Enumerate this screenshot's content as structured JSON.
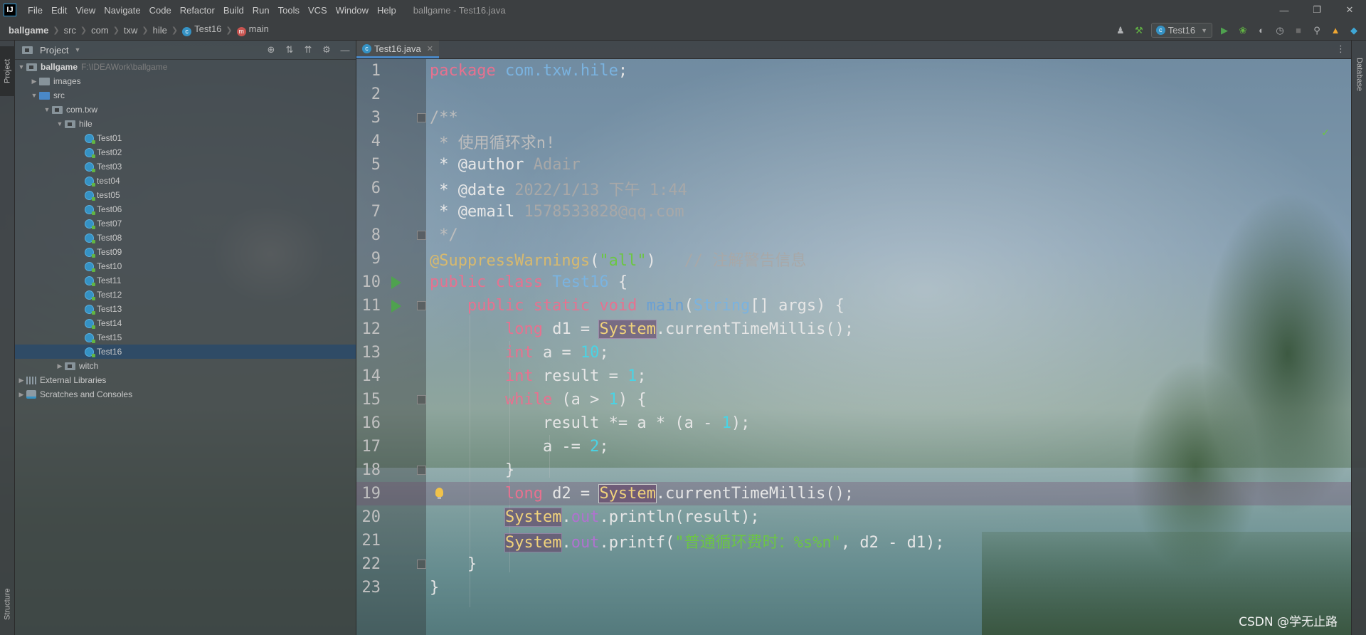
{
  "app": {
    "logo": "IJ",
    "menu": [
      "File",
      "Edit",
      "View",
      "Navigate",
      "Code",
      "Refactor",
      "Build",
      "Run",
      "Tools",
      "VCS",
      "Window",
      "Help"
    ],
    "window_title": "ballgame - Test16.java"
  },
  "breadcrumb": {
    "items": [
      "ballgame",
      "src",
      "com",
      "txw",
      "hile"
    ],
    "class_name": "Test16",
    "method_name": "main"
  },
  "toolbar": {
    "run_config": "Test16",
    "icons": [
      "user-icon",
      "build-hammer-icon",
      "run-icon",
      "debug-icon",
      "coverage-icon",
      "profile-icon",
      "stop-icon",
      "search-icon",
      "update-icon",
      "plugin-icon"
    ]
  },
  "side": {
    "project_label": "Project",
    "structure_label": "Structure",
    "database_label": "Database"
  },
  "project_panel": {
    "title": "Project",
    "root": {
      "name": "ballgame",
      "path": "F:\\IDEAWork\\ballgame"
    },
    "folders": {
      "images": "images",
      "src": "src",
      "pkg": "com.txw",
      "hile": "hile",
      "witch": "witch"
    },
    "files": [
      "Test01",
      "Test02",
      "Test03",
      "test04",
      "test05",
      "Test06",
      "Test07",
      "Test08",
      "Test09",
      "Test10",
      "Test11",
      "Test12",
      "Test13",
      "Test14",
      "Test15",
      "Test16"
    ],
    "selected_file": "Test16",
    "external_libraries": "External Libraries",
    "scratches": "Scratches and Consoles"
  },
  "editor": {
    "tab": "Test16.java",
    "line_numbers": [
      "1",
      "2",
      "3",
      "4",
      "5",
      "6",
      "7",
      "8",
      "9",
      "10",
      "11",
      "12",
      "13",
      "14",
      "15",
      "16",
      "17",
      "18",
      "19",
      "20",
      "21",
      "22",
      "23"
    ],
    "code": {
      "l1_kw": "package",
      "l1_pkg": "com.txw.hile",
      "l1_end": ";",
      "l3": "/**",
      "l4": " * 使用循环求n!",
      "l5_tag": " * @author",
      "l5_val": " Adair",
      "l6_tag": " * @date",
      "l6_val": " 2022/1/13 下午 1:44",
      "l7_tag": " * @email",
      "l7_val": " 1578533828@qq.com",
      "l8": " */",
      "l9_ann": "@SuppressWarnings",
      "l9_open": "(",
      "l9_str": "\"all\"",
      "l9_close": ")",
      "l9_comment": "   // 注解警告信息",
      "l10_kw": "public class",
      "l10_cls": "Test16",
      "l10_end": " {",
      "l11_kw": "    public static void",
      "l11_m": "main",
      "l11_p": "(",
      "l11_t": "String",
      "l11_rest": "[] args) {",
      "l12_kw": "        long",
      "l12_mid": " d1 = ",
      "sys": "System",
      "l12_rest": ".currentTimeMillis();",
      "l13_kw": "        int",
      "l13_mid": " a = ",
      "l13_num": "10",
      "l13_end": ";",
      "l14_kw": "        int",
      "l14_mid": " result = ",
      "l14_num": "1",
      "l14_end": ";",
      "l15_kw": "        while",
      "l15_mid": " (a > ",
      "l15_num": "1",
      "l15_end": ") {",
      "l16_mid": "            result *= a * (a - ",
      "l16_num": "1",
      "l16_end": ");",
      "l17_mid": "            a -= ",
      "l17_num": "2",
      "l17_end": ";",
      "l18": "        }",
      "l19_kw": "        long",
      "l19_mid": " d2 = ",
      "l19_rest": ".currentTimeMillis();",
      "out": "out",
      "l20_rest": ".println(result);",
      "l21_mid": ".printf(",
      "l21_str": "\"普通循环费时：%s%n\"",
      "l21_end": ", d2 - d1);",
      "l22": "    }",
      "l23": "}"
    }
  },
  "watermark": "CSDN @学无止路",
  "colors": {
    "keyword": "#e8718f",
    "string": "#6cc644",
    "number": "#49d4e5",
    "annotation": "#d7b96e",
    "selection": "#2f4b66"
  }
}
